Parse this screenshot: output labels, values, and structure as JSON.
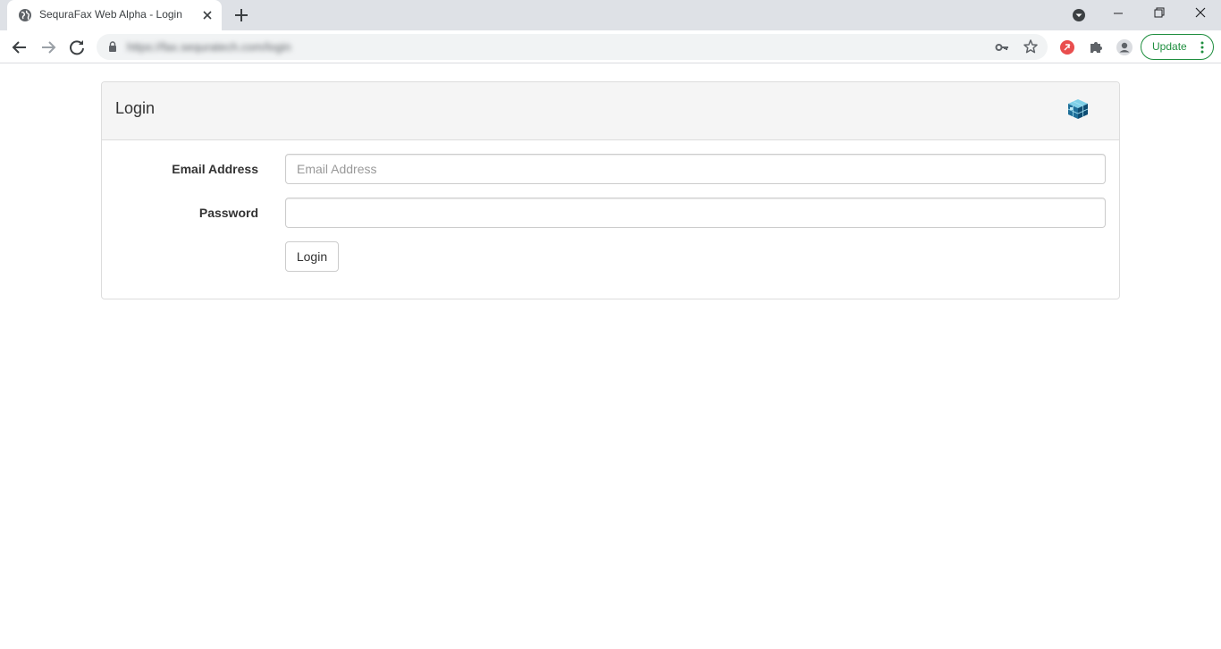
{
  "browser": {
    "tab": {
      "title": "SequraFax Web Alpha - Login"
    },
    "toolbar": {
      "url": "https://fax.sequratech.com/login",
      "update_label": "Update"
    },
    "icons": {
      "tab_favicon": "globe-icon",
      "tab_close": "close-icon",
      "new_tab": "plus-icon",
      "tab_search": "chevron-down-circle-icon",
      "minimize": "minimize-icon",
      "restore": "restore-icon",
      "close_window": "close-icon",
      "back": "arrow-left-icon",
      "forward": "arrow-right-icon",
      "reload": "reload-icon",
      "lock": "lock-icon",
      "password_key": "key-icon",
      "bookmark": "star-icon",
      "extension_red": "red-extension-icon",
      "extensions": "puzzle-icon",
      "profile": "profile-icon",
      "menu": "kebab-menu-icon"
    },
    "colors": {
      "update_green": "#1e8e3e",
      "tabstrip_bg": "#dee1e6"
    }
  },
  "page": {
    "panel_title": "Login",
    "logo": "cube-logo",
    "form": {
      "email_label": "Email Address",
      "email_placeholder": "Email Address",
      "email_value": "",
      "password_label": "Password",
      "password_value": "",
      "submit_label": "Login"
    }
  }
}
